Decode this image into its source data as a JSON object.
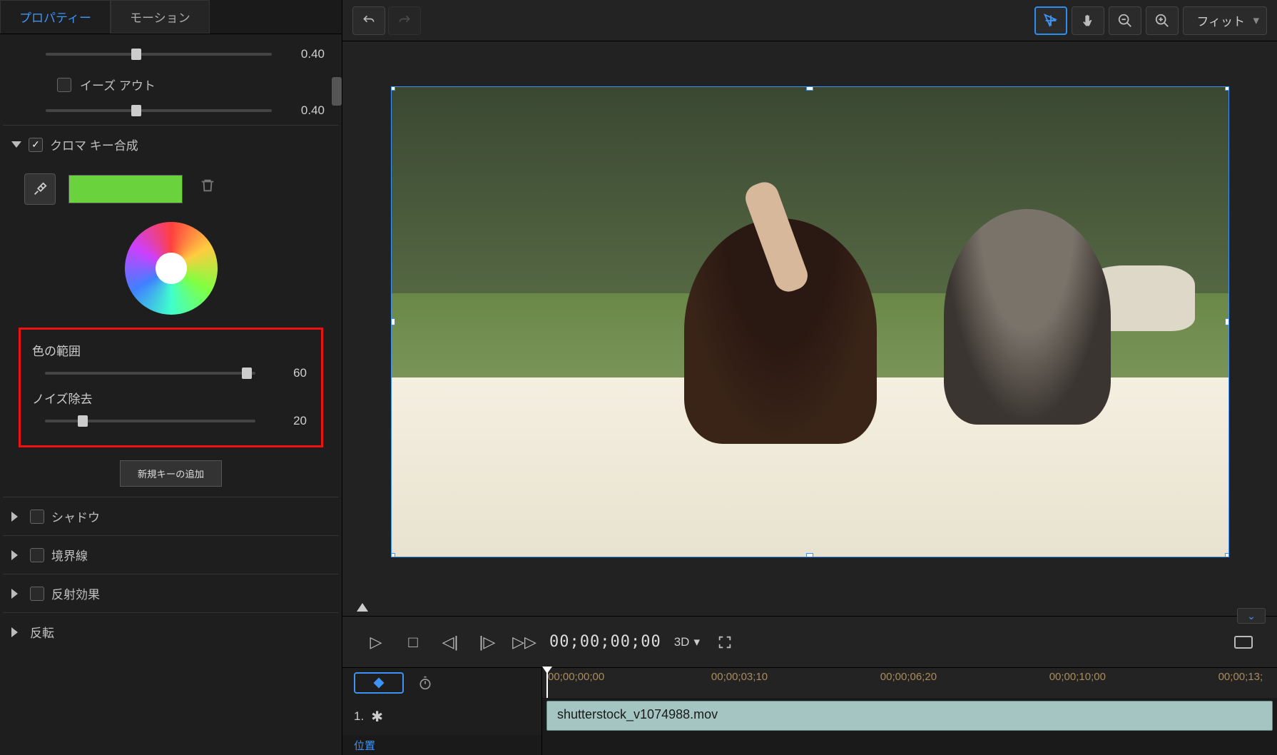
{
  "tabs": {
    "properties": "プロパティー",
    "motion": "モーション"
  },
  "easeOut": {
    "label": "イーズ アウト",
    "preValue": "0.40",
    "value": "0.40"
  },
  "chroma": {
    "title": "クロマ キー合成",
    "swatchColor": "#6ad23c",
    "colorRange": {
      "label": "色の範囲",
      "value": "60"
    },
    "denoise": {
      "label": "ノイズ除去",
      "value": "20"
    },
    "addKey": "新規キーの追加"
  },
  "sections": {
    "shadow": "シャドウ",
    "border": "境界線",
    "reflection": "反射効果",
    "flip": "反転"
  },
  "toolbar": {
    "fit": "フィット"
  },
  "playback": {
    "timecode": "00;00;00;00",
    "threeD": "3D"
  },
  "timeline": {
    "marks": [
      "00;00;00;00",
      "00;00;03;10",
      "00;00;06;20",
      "00;00;10;00",
      "00;00;13;"
    ],
    "trackNum": "1.",
    "clipName": "shutterstock_v1074988.mov",
    "row2": "位置"
  }
}
